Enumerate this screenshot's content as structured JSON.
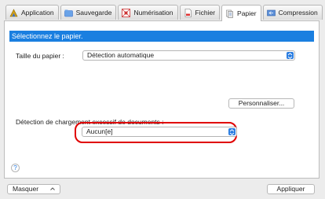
{
  "tabs": [
    {
      "label": "Application",
      "icon": "application-icon",
      "active": false
    },
    {
      "label": "Sauvegarde",
      "icon": "save-folder-icon",
      "active": false
    },
    {
      "label": "Numérisation",
      "icon": "scan-icon",
      "active": false
    },
    {
      "label": "Fichier",
      "icon": "file-icon",
      "active": false
    },
    {
      "label": "Papier",
      "icon": "paper-icon",
      "active": true
    },
    {
      "label": "Compression",
      "icon": "compression-icon",
      "active": false
    }
  ],
  "section": {
    "title": "Sélectionnez le papier."
  },
  "paper_size": {
    "label": "Taille du papier :",
    "value": "Détection automatique"
  },
  "customize_button": {
    "label": "Personnaliser..."
  },
  "overload_detection": {
    "label": "Détection de chargement excessif de documents :",
    "value": "Aucun[e]"
  },
  "help": {
    "label": "?"
  },
  "footer": {
    "hide_label": "Masquer",
    "apply_label": "Appliquer"
  },
  "colors": {
    "accent": "#1a7fe0",
    "highlight": "#e00000"
  }
}
